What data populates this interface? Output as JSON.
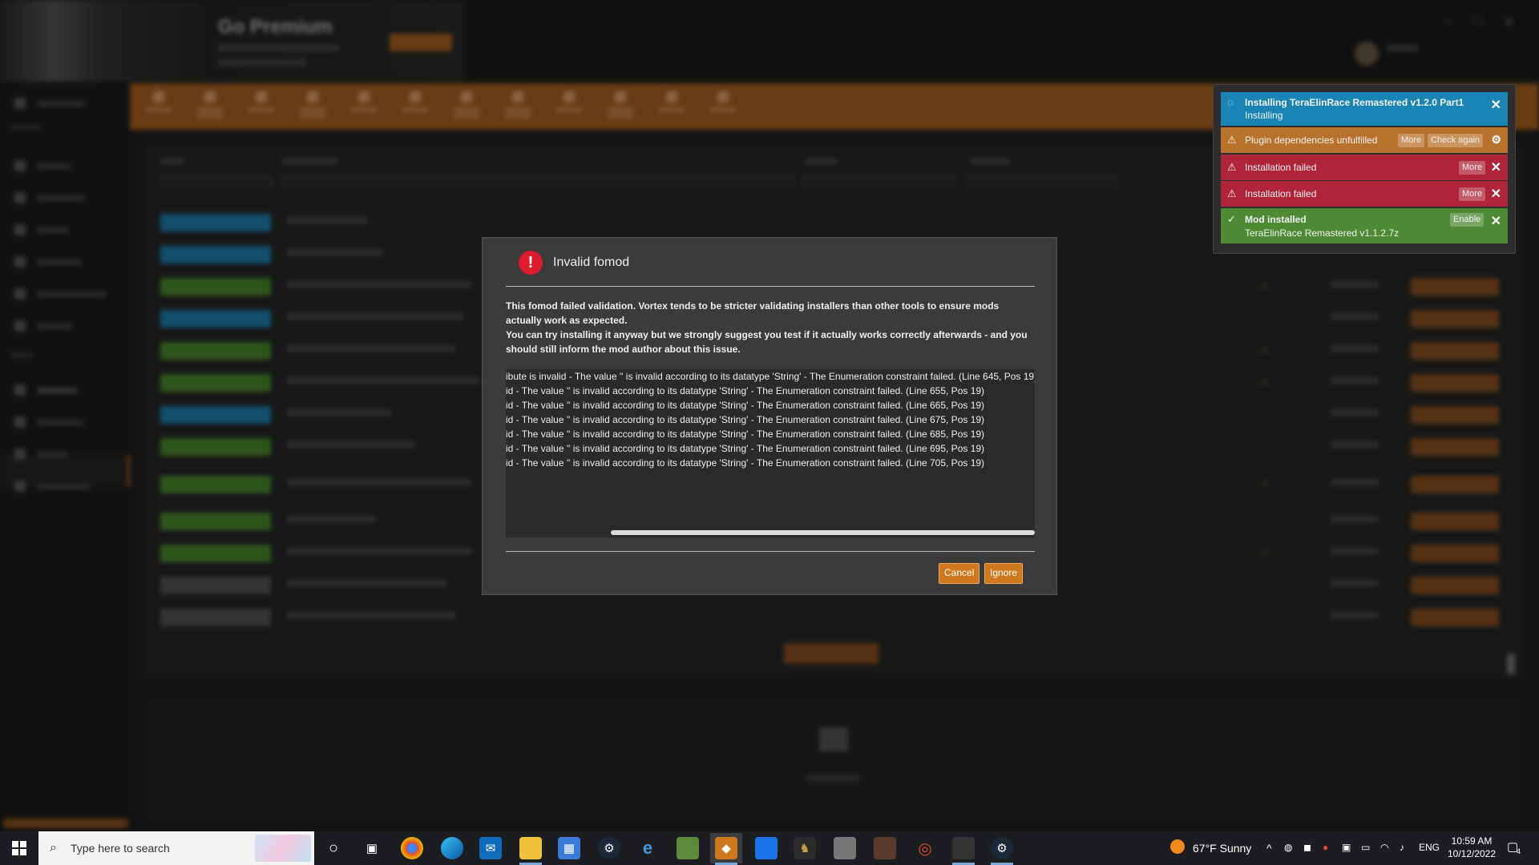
{
  "dialog": {
    "title": "Invalid fomod",
    "message_1": "This fomod failed validation. Vortex tends to be stricter validating installers than other tools to ensure mods actually work as expected.",
    "message_2": "You can try installing it anyway but we strongly suggest you test if it actually works correctly afterwards - and you should still inform the mod author about this issue.",
    "log_lines": [
      "ibute is invalid - The value '' is invalid according to its datatype 'String' - The Enumeration constraint failed. (Line 645, Pos 19)",
      "id - The value '' is invalid according to its datatype 'String' - The Enumeration constraint failed. (Line 655, Pos 19)",
      "id - The value '' is invalid according to its datatype 'String' - The Enumeration constraint failed. (Line 665, Pos 19)",
      "id - The value '' is invalid according to its datatype 'String' - The Enumeration constraint failed. (Line 675, Pos 19)",
      "id - The value '' is invalid according to its datatype 'String' - The Enumeration constraint failed. (Line 685, Pos 19)",
      "id - The value '' is invalid according to its datatype 'String' - The Enumeration constraint failed. (Line 695, Pos 19)",
      "id - The value '' is invalid according to its datatype 'String' - The Enumeration constraint failed. (Line 705, Pos 19)"
    ],
    "cancel_label": "Cancel",
    "ignore_label": "Ignore"
  },
  "notifications": [
    {
      "title": "Installing TeraElinRace Remastered v1.2.0 Part1",
      "subtitle": "Installing",
      "color": "#1a85b5"
    },
    {
      "title": "Plugin dependencies unfulfilled",
      "more": "More",
      "check": "Check again",
      "color": "#b8722c"
    },
    {
      "title": "Installation failed",
      "more": "More",
      "color": "#b0243a"
    },
    {
      "title": "Installation failed",
      "more": "More",
      "color": "#b0243a"
    },
    {
      "title": "Mod installed",
      "subtitle": "TeraElinRace Remastered v1.1.2.7z",
      "enable": "Enable",
      "color": "#4e8a33"
    }
  ],
  "background": {
    "banner_title": "Go Premium"
  },
  "taskbar": {
    "search_placeholder": "Type here to search",
    "weather": "67°F  Sunny",
    "language": "ENG",
    "time": "10:59 AM",
    "date": "10/12/2022",
    "notification_count": "4"
  },
  "colors": {
    "accent": "#d0781e",
    "toolbar": "#a8601f",
    "error": "#e01b2e"
  }
}
